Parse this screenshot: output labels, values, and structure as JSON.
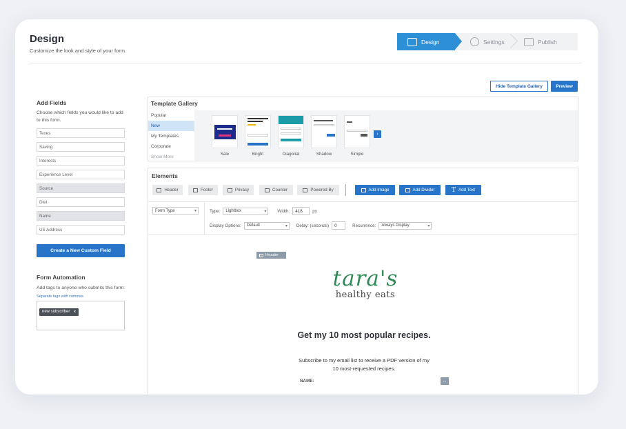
{
  "page": {
    "title": "Design",
    "subtitle": "Customize the look and style of your form."
  },
  "stepper": {
    "steps": [
      {
        "label": "Design",
        "icon": "hand-pointer-icon",
        "active": true
      },
      {
        "label": "Settings",
        "icon": "gear-icon",
        "active": false
      },
      {
        "label": "Publish",
        "icon": "browser-icon",
        "active": false
      }
    ]
  },
  "toolbar": {
    "hide_gallery_label": "Hide Template Gallery",
    "preview_label": "Preview"
  },
  "add_fields": {
    "title": "Add Fields",
    "description": "Choose which fields you would like to add to this form.",
    "fields": [
      {
        "label": "Texes",
        "added": false
      },
      {
        "label": "Saving",
        "added": false
      },
      {
        "label": "Interests",
        "added": false
      },
      {
        "label": "Experience Level",
        "added": false
      },
      {
        "label": "Source",
        "added": true
      },
      {
        "label": "Diet",
        "added": false
      },
      {
        "label": "Name",
        "added": true
      },
      {
        "label": "US Address",
        "added": false
      }
    ],
    "create_button_label": "Create a New Custom Field"
  },
  "automation": {
    "title": "Form Automation",
    "description": "Add tags to anyone who submits this form:",
    "hint": "Separate tags with commas",
    "tags": [
      "new subscriber"
    ]
  },
  "gallery": {
    "title": "Template Gallery",
    "categories": [
      "Popular",
      "New",
      "My Templates",
      "Corporate",
      "Show More"
    ],
    "active_category": "New",
    "templates": [
      "Sale",
      "Bright",
      "Diagonal",
      "Shadow",
      "Simple"
    ]
  },
  "elements": {
    "title": "Elements",
    "toggles": [
      "Header",
      "Footer",
      "Privacy",
      "Counter",
      "Powered By"
    ],
    "add_buttons": [
      "Add Image",
      "Add Divider",
      "Add Text"
    ],
    "form_type_label": "Form Type",
    "type_label": "Type:",
    "type_value": "Lightbox",
    "width_label": "Width:",
    "width_value": "418",
    "width_unit": "px",
    "display_label": "Display Options:",
    "display_value": "Default",
    "delay_label": "Delay: (seconds)",
    "delay_value": "0",
    "recurrence_label": "Recurrence:",
    "recurrence_value": "Always Display"
  },
  "preview": {
    "header_chip": "Header",
    "logo_script": "tara's",
    "logo_sub": "healthy eats",
    "headline": "Get my 10 most popular recipes.",
    "subtext": "Subscribe to my email list to receive a PDF version of my 10 most-requested recipes.",
    "name_label": "NAME:",
    "resize_glyph": "↔"
  },
  "colors": {
    "accent": "#2874c8",
    "stepper_active": "#2d8fd5",
    "logo_green": "#2f8a56"
  }
}
